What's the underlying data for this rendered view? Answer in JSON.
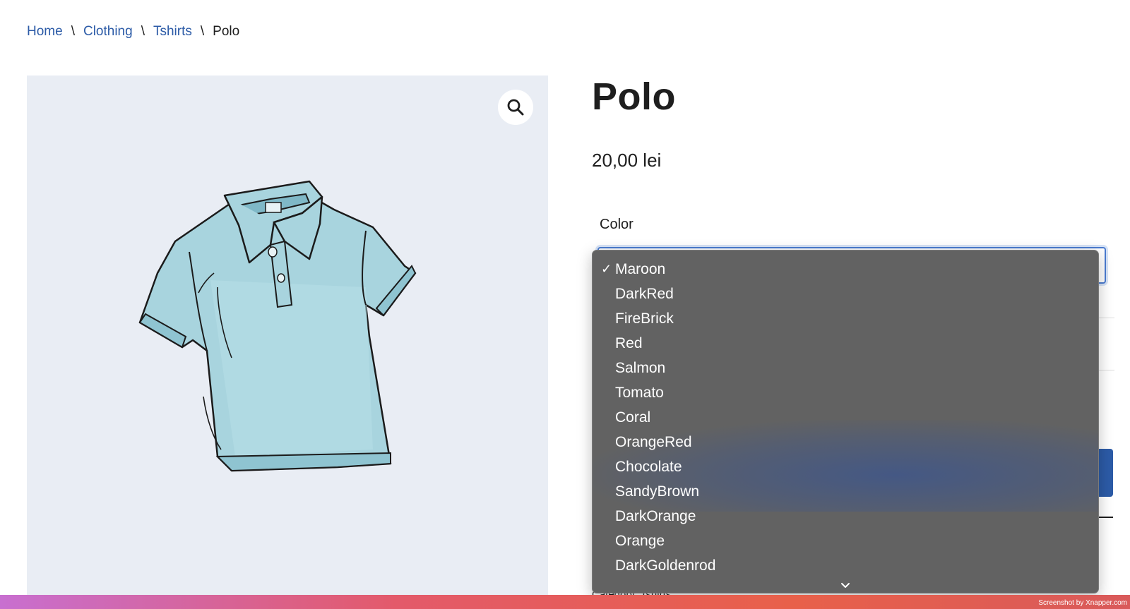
{
  "breadcrumb": {
    "items": [
      "Home",
      "Clothing",
      "Tshirts"
    ],
    "current": "Polo",
    "separator": "\\"
  },
  "product": {
    "title": "Polo",
    "price": "20,00 lei",
    "image_icon": "polo-shirt-illustration"
  },
  "variations": {
    "color_label": "Color",
    "selected": "Maroon",
    "options": [
      "Maroon",
      "DarkRed",
      "FireBrick",
      "Red",
      "Salmon",
      "Tomato",
      "Coral",
      "OrangeRed",
      "Chocolate",
      "SandyBrown",
      "DarkOrange",
      "Orange",
      "DarkGoldenrod"
    ]
  },
  "meta": {
    "category_label": "Category: Tshirts"
  },
  "footer": {
    "watermark": "Screenshot by Xnapper.com"
  },
  "colors": {
    "link": "#2c5ba7",
    "dropdown_bg": "#626262",
    "image_bg": "#e9edf4",
    "shirt": "#a8d4de"
  }
}
